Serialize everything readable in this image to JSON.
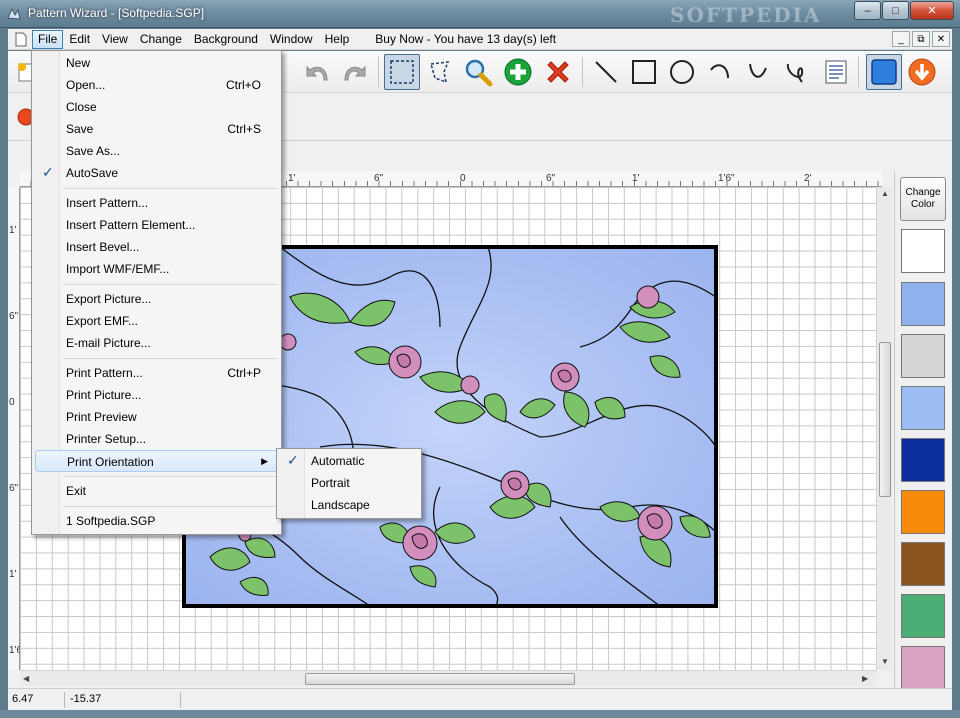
{
  "window": {
    "title": "Pattern Wizard - [Softpedia.SGP]",
    "watermark": "SOFTPEDIA",
    "minimize": "–",
    "restore": "□",
    "close": "✕"
  },
  "menubar": {
    "items": [
      "File",
      "Edit",
      "View",
      "Change",
      "Background",
      "Window",
      "Help"
    ],
    "buy": "Buy Now - You have 13 day(s) left",
    "mdi_min": "_",
    "mdi_restore": "⧉",
    "mdi_close": "✕"
  },
  "file_menu": {
    "new": "New",
    "open": "Open...",
    "open_sc": "Ctrl+O",
    "close": "Close",
    "save": "Save",
    "save_sc": "Ctrl+S",
    "save_as": "Save As...",
    "autosave": "AutoSave",
    "insert_pattern": "Insert Pattern...",
    "insert_pattern_element": "Insert Pattern Element...",
    "insert_bevel": "Insert Bevel...",
    "import_wmf": "Import WMF/EMF...",
    "export_picture": "Export Picture...",
    "export_emf": "Export EMF...",
    "email_picture": "E-mail Picture...",
    "print_pattern": "Print Pattern...",
    "print_pattern_sc": "Ctrl+P",
    "print_picture": "Print Picture...",
    "print_preview": "Print Preview",
    "printer_setup": "Printer Setup...",
    "print_orientation": "Print Orientation",
    "exit": "Exit",
    "recent_1": "1 Softpedia.SGP"
  },
  "orientation_menu": {
    "automatic": "Automatic",
    "portrait": "Portrait",
    "landscape": "Landscape"
  },
  "ruler_top": [
    "1'",
    "6\"",
    "0",
    "6\"",
    "1'",
    "1'6\"",
    "2'"
  ],
  "ruler_left": [
    "1'",
    "6\"",
    "0",
    "6\"",
    "1'",
    "1'6\""
  ],
  "palette": {
    "change_color": "Change Color",
    "swatches": [
      "#ffffff",
      "#8fb2ee",
      "#d6d6d6",
      "#9cbcf2",
      "#0d2f9e",
      "#f78a0a",
      "#8a5420",
      "#4bad74",
      "#d9a4c4"
    ]
  },
  "status": {
    "x": "6.47",
    "y": "-15.37"
  }
}
